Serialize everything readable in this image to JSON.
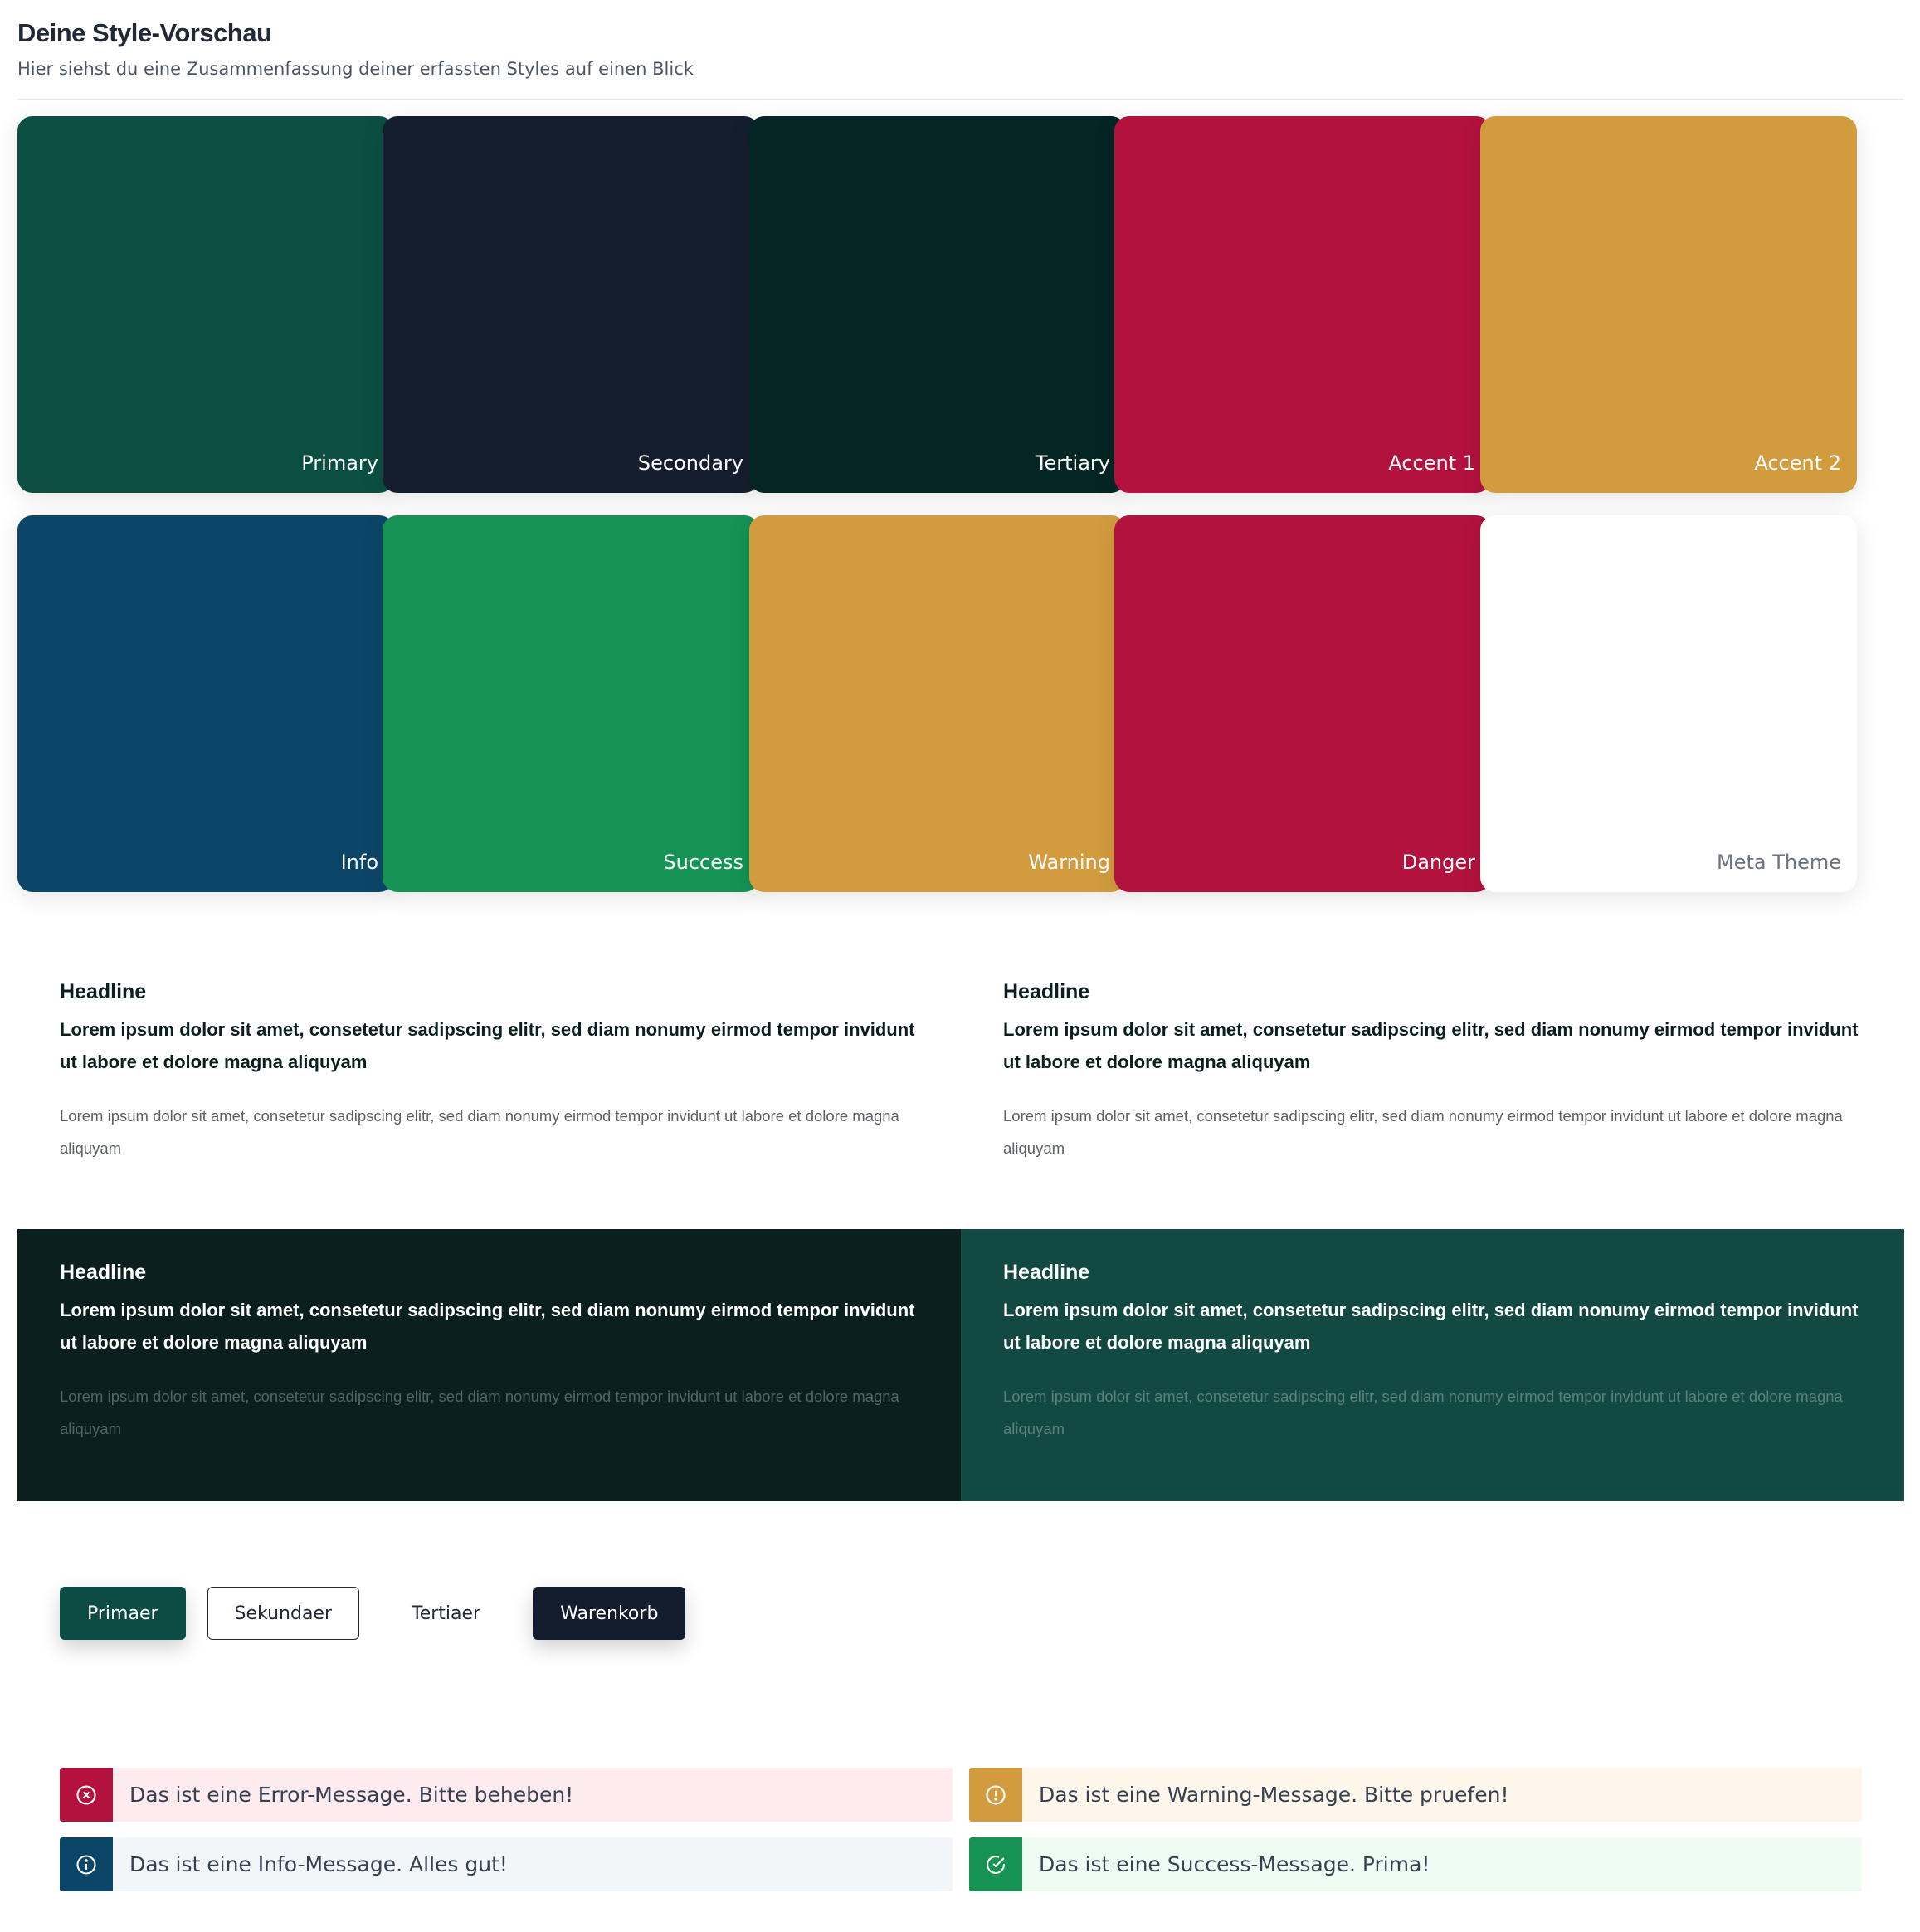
{
  "header": {
    "title": "Deine Style-Vorschau",
    "subtitle": "Hier siehst du eine Zusammenfassung deiner erfassten Styles auf einen Blick"
  },
  "swatches": {
    "row1": [
      {
        "label": "Primary",
        "color": "#0b4f43"
      },
      {
        "label": "Secondary",
        "color": "#151e2e"
      },
      {
        "label": "Tertiary",
        "color": "#032624"
      },
      {
        "label": "Accent 1",
        "color": "#b2123d"
      },
      {
        "label": "Accent 2",
        "color": "#d29b3e"
      }
    ],
    "row2": [
      {
        "label": "Info",
        "color": "#0b4669"
      },
      {
        "label": "Success",
        "color": "#169354"
      },
      {
        "label": "Warning",
        "color": "#d29b3e"
      },
      {
        "label": "Danger",
        "color": "#b2123d"
      },
      {
        "label": "Meta Theme",
        "color": "#ffffff"
      }
    ]
  },
  "typography": [
    {
      "headline": "Headline",
      "lead": "Lorem ipsum dolor sit amet, consetetur sadipscing elitr, sed diam nonumy eirmod tempor invidunt ut labore et dolore magna aliquyam",
      "body": "Lorem ipsum dolor sit amet, consetetur sadipscing elitr, sed diam nonumy eirmod tempor invidunt ut labore et dolore magna aliquyam",
      "background": "#ffffff"
    },
    {
      "headline": "Headline",
      "lead": "Lorem ipsum dolor sit amet, consetetur sadipscing elitr, sed diam nonumy eirmod tempor invidunt ut labore et dolore magna aliquyam",
      "body": "Lorem ipsum dolor sit amet, consetetur sadipscing elitr, sed diam nonumy eirmod tempor invidunt ut labore et dolore magna aliquyam",
      "background": "#ffffff"
    },
    {
      "headline": "Headline",
      "lead": "Lorem ipsum dolor sit amet, consetetur sadipscing elitr, sed diam nonumy eirmod tempor invidunt ut labore et dolore magna aliquyam",
      "body": "Lorem ipsum dolor sit amet, consetetur sadipscing elitr, sed diam nonumy eirmod tempor invidunt ut labore et dolore magna aliquyam",
      "background": "#0b1f1e"
    },
    {
      "headline": "Headline",
      "lead": "Lorem ipsum dolor sit amet, consetetur sadipscing elitr, sed diam nonumy eirmod tempor invidunt ut labore et dolore magna aliquyam",
      "body": "Lorem ipsum dolor sit amet, consetetur sadipscing elitr, sed diam nonumy eirmod tempor invidunt ut labore et dolore magna aliquyam",
      "background": "#134943"
    }
  ],
  "buttons": {
    "primary": "Primaer",
    "secondary": "Sekundaer",
    "tertiary": "Tertiaer",
    "cart": "Warenkorb"
  },
  "alerts": {
    "error": {
      "text": "Das ist eine Error-Message. Bitte beheben!",
      "icon": "x-circle-icon",
      "accent": "#b2123d",
      "background": "#fdebef"
    },
    "warning": {
      "text": "Das ist eine Warning-Message. Bitte pruefen!",
      "icon": "alert-circle-icon",
      "accent": "#d29b3e",
      "background": "#fef6ea"
    },
    "info": {
      "text": "Das ist eine Info-Message. Alles gut!",
      "icon": "info-circle-icon",
      "accent": "#0b4669",
      "background": "#f3f6f8"
    },
    "success": {
      "text": "Das ist eine Success-Message. Prima!",
      "icon": "check-circle-icon",
      "accent": "#169354",
      "background": "#eefbf3"
    }
  }
}
